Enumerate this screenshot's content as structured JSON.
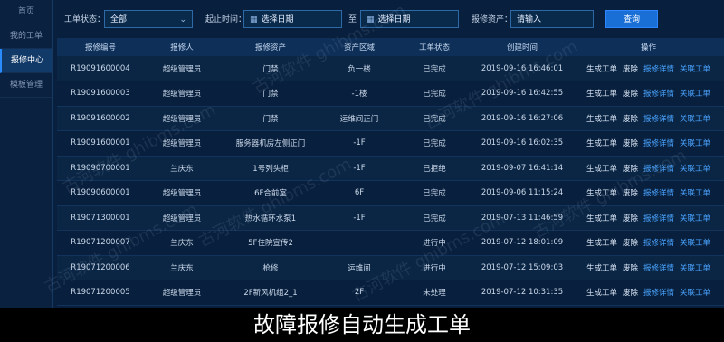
{
  "sidebar": {
    "items": [
      {
        "label": "首页"
      },
      {
        "label": "我的工单"
      },
      {
        "label": "报修中心"
      },
      {
        "label": "模板管理"
      }
    ]
  },
  "filters": {
    "status_label": "工单状态：",
    "status_value": "全部",
    "time_label": "起止时间：",
    "start_placeholder": "选择日期",
    "to_label": "至",
    "end_placeholder": "选择日期",
    "asset_label": "报修资产：",
    "asset_placeholder": "请输入",
    "search_label": "查询"
  },
  "table": {
    "headers": [
      "报修编号",
      "报修人",
      "报修资产",
      "资产区域",
      "工单状态",
      "创建时间",
      "操作"
    ],
    "rows": [
      [
        "R19091600004",
        "超级管理员",
        "门禁",
        "负一楼",
        "已完成",
        "2019-09-16 16:46:01"
      ],
      [
        "R19091600003",
        "超级管理员",
        "门禁",
        "-1楼",
        "已完成",
        "2019-09-16 16:42:55"
      ],
      [
        "R19091600002",
        "超级管理员",
        "门禁",
        "运维间正门",
        "已完成",
        "2019-09-16 16:27:06"
      ],
      [
        "R19091600001",
        "超级管理员",
        "服务器机房左侧正门",
        "-1F",
        "已完成",
        "2019-09-16 16:02:35"
      ],
      [
        "R19090700001",
        "兰庆东",
        "1号列头柜",
        "-1F",
        "已拒绝",
        "2019-09-07 16:41:14"
      ],
      [
        "R19090600001",
        "超级管理员",
        "6F合前室",
        "6F",
        "已完成",
        "2019-09-06 11:15:24"
      ],
      [
        "R19071300001",
        "超级管理员",
        "热水循环水泵1",
        "-1F",
        "已完成",
        "2019-07-13 11:46:59"
      ],
      [
        "R19071200007",
        "兰庆东",
        "5F住院宣传2",
        "",
        "进行中",
        "2019-07-12 18:01:09"
      ],
      [
        "R19071200006",
        "兰庆东",
        "枪修",
        "运维间",
        "进行中",
        "2019-07-12 15:09:03"
      ],
      [
        "R19071200005",
        "超级管理员",
        "2F新风机组2_1",
        "2F",
        "未处理",
        "2019-07-12 10:31:35"
      ]
    ],
    "ops": [
      "生成工单",
      "废除",
      "报修详情",
      "关联工单"
    ]
  },
  "watermark": "古河软件 ghibms.com",
  "caption": "故障报修自动生成工单",
  "colors": {
    "accent": "#1a6fd6",
    "link": "#4aa3ff",
    "background": "#071a33"
  }
}
